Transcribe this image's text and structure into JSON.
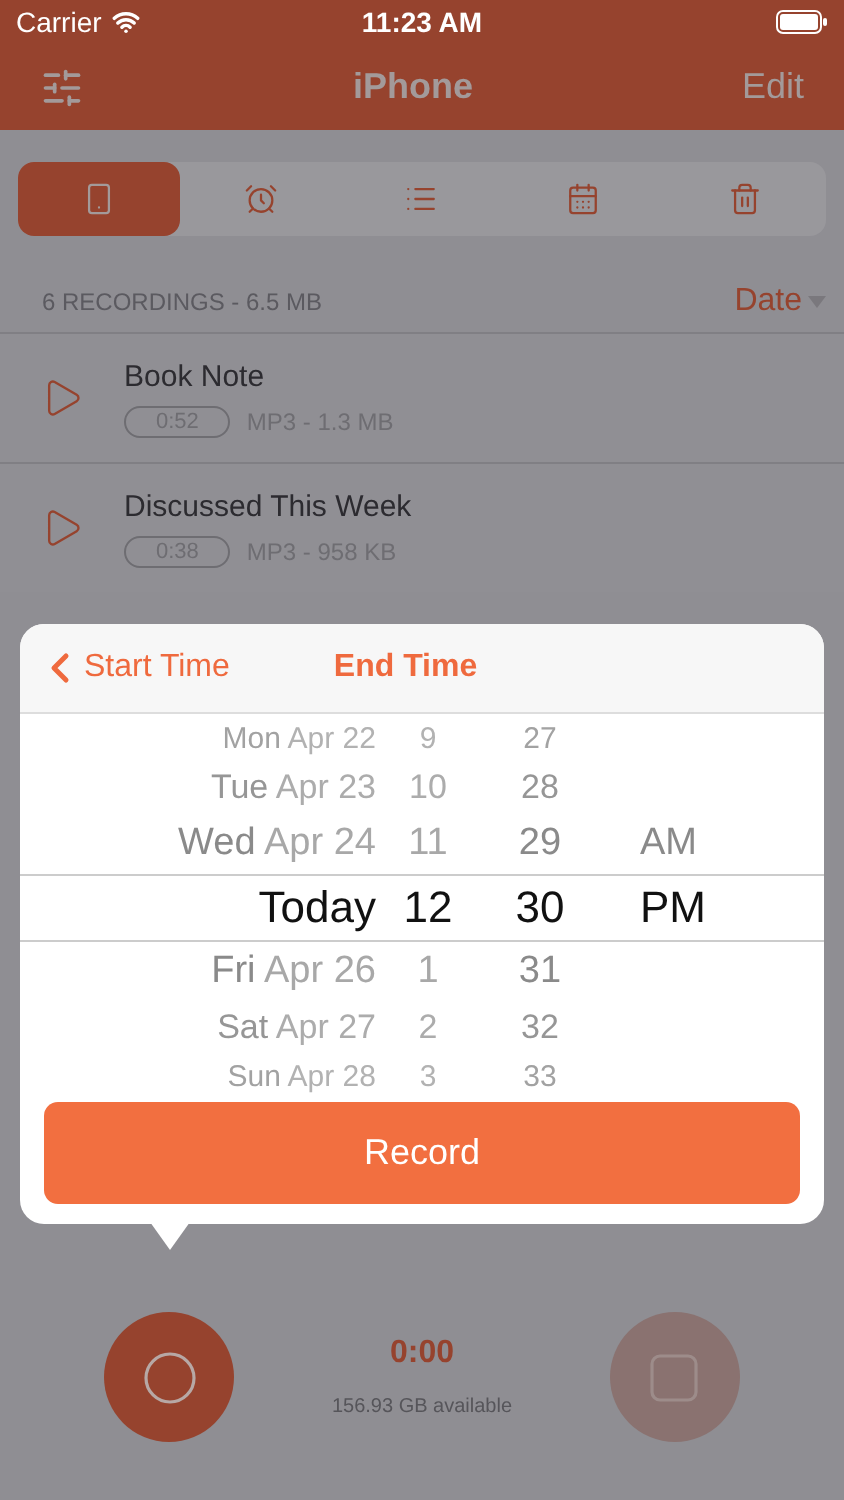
{
  "status_bar": {
    "carrier": "Carrier",
    "time": "11:23 AM"
  },
  "nav": {
    "title": "iPhone",
    "right": "Edit"
  },
  "tabs": [
    {
      "selected": true
    },
    {
      "selected": false
    },
    {
      "selected": false
    },
    {
      "selected": false
    },
    {
      "selected": false
    }
  ],
  "section": {
    "summary": "6 RECORDINGS - 6.5 MB",
    "sort": "Date"
  },
  "recordings": [
    {
      "title": "Book Note",
      "duration": "0:52",
      "info": "MP3 - 1.3 MB"
    },
    {
      "title": "Discussed This Week",
      "duration": "0:38",
      "info": "MP3 - 958 KB"
    }
  ],
  "popover": {
    "back": "Start Time",
    "title": "End Time",
    "rows": [
      {
        "day": "Mon",
        "date": "Apr 22",
        "hour": "9",
        "minute": "27",
        "selected": false
      },
      {
        "day": "Tue",
        "date": "Apr 23",
        "hour": "10",
        "minute": "28",
        "selected": false
      },
      {
        "day": "Wed",
        "date": "Apr 24",
        "hour": "11",
        "minute": "29",
        "period": "AM",
        "selected": false
      },
      {
        "day": "Today",
        "hour": "12",
        "minute": "30",
        "period": "PM",
        "selected": true
      },
      {
        "day": "Fri",
        "date": "Apr 26",
        "hour": "1",
        "minute": "31",
        "selected": false
      },
      {
        "day": "Sat",
        "date": "Apr 27",
        "hour": "2",
        "minute": "32",
        "selected": false
      },
      {
        "day": "Sun",
        "date": "Apr 28",
        "hour": "3",
        "minute": "33",
        "selected": false
      }
    ],
    "button": "Record"
  },
  "footer": {
    "timer": "0:00",
    "available": "156.93 GB available"
  }
}
